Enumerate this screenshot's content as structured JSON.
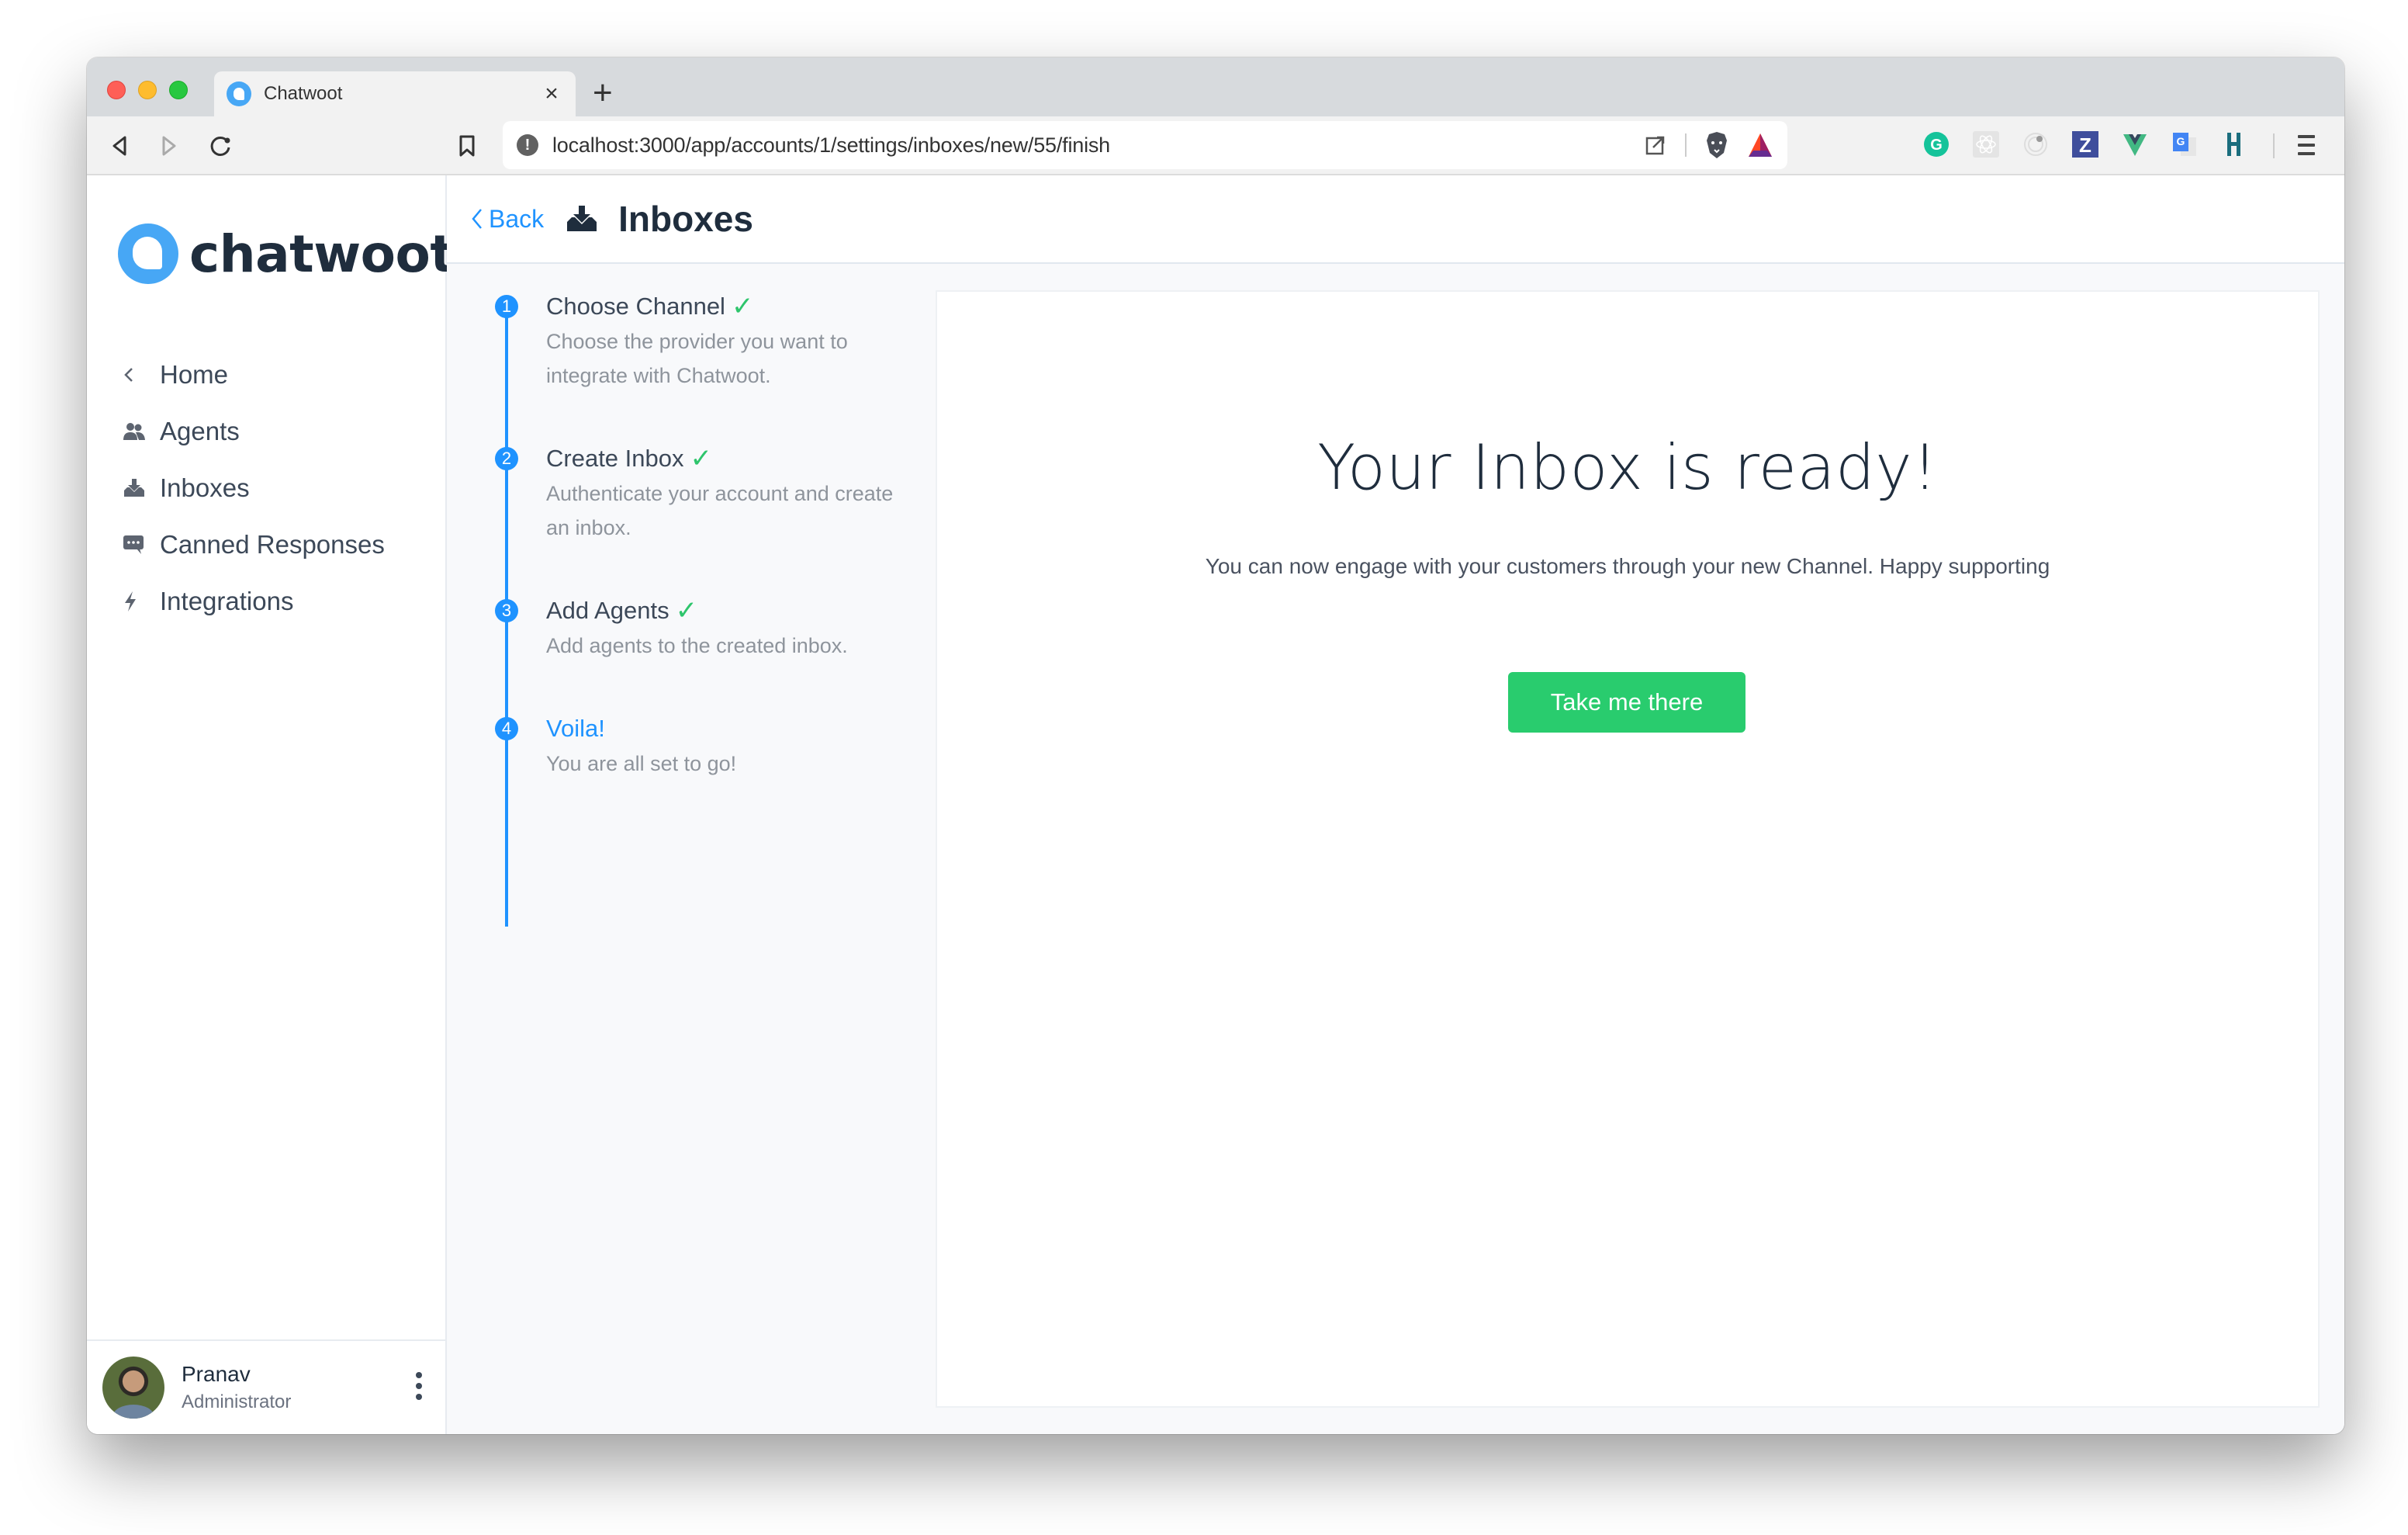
{
  "browser": {
    "tab_title": "Chatwoot",
    "tab_close": "×",
    "new_tab": "+",
    "url": "localhost:3000/app/accounts/1/settings/inboxes/new/55/finish",
    "extensions": [
      "grammarly-icon",
      "react-devtools-icon",
      "extension-icon",
      "zotero-icon",
      "vue-devtools-icon",
      "google-translate-icon",
      "extension-bars-icon"
    ]
  },
  "brand": {
    "name": "chatwoot",
    "accent": "#1f93ff",
    "success": "#29cc6e"
  },
  "sidebar": {
    "items": [
      {
        "label": "Home",
        "icon": "chevron-left-icon"
      },
      {
        "label": "Agents",
        "icon": "users-icon"
      },
      {
        "label": "Inboxes",
        "icon": "inbox-download-icon"
      },
      {
        "label": "Canned Responses",
        "icon": "chat-bubble-icon"
      },
      {
        "label": "Integrations",
        "icon": "bolt-icon"
      }
    ],
    "user": {
      "name": "Pranav",
      "role": "Administrator"
    }
  },
  "header": {
    "back_label": "Back",
    "title": "Inboxes"
  },
  "wizard": {
    "steps": [
      {
        "number": "1",
        "title": "Choose Channel",
        "description": "Choose the provider you want to integrate with Chatwoot.",
        "done": true
      },
      {
        "number": "2",
        "title": "Create Inbox",
        "description": "Authenticate your account and create an inbox.",
        "done": true
      },
      {
        "number": "3",
        "title": "Add Agents",
        "description": "Add agents to the created inbox.",
        "done": true
      },
      {
        "number": "4",
        "title": "Voila!",
        "description": "You are all set to go!",
        "done": false,
        "active": true
      }
    ]
  },
  "finish": {
    "title": "Your Inbox is ready!",
    "subtitle": "You can now engage with your customers through your new Channel. Happy supporting",
    "cta_label": "Take me there"
  }
}
